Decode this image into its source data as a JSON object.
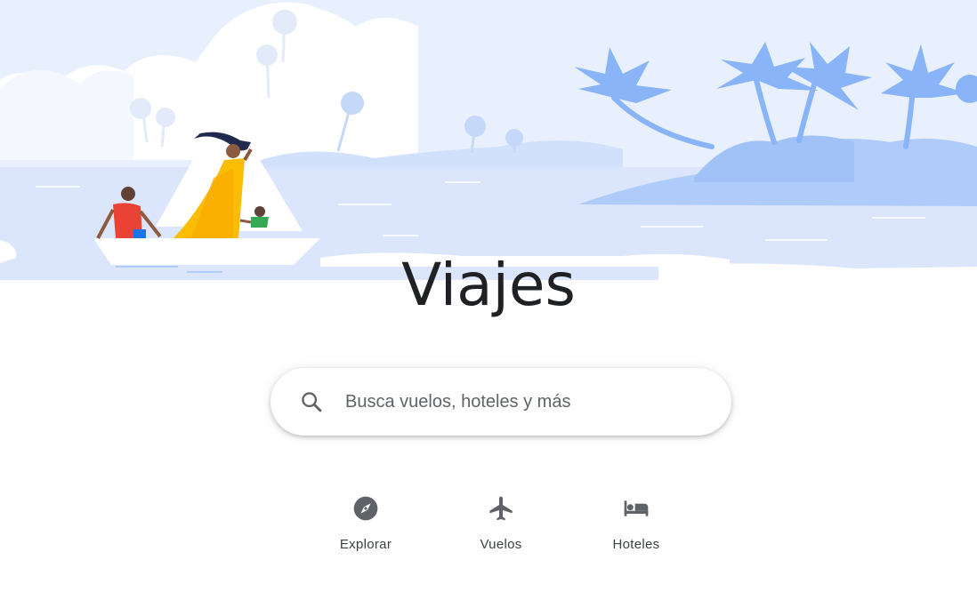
{
  "page": {
    "title": "Viajes"
  },
  "search": {
    "placeholder": "Busca vuelos, hoteles y más",
    "icon": "search-icon"
  },
  "nav": {
    "items": [
      {
        "label": "Explorar",
        "icon": "compass-icon"
      },
      {
        "label": "Vuelos",
        "icon": "airplane-icon"
      },
      {
        "label": "Hoteles",
        "icon": "bed-icon"
      }
    ]
  },
  "colors": {
    "sky": "#e8f0fe",
    "water": "#dbe6fc",
    "island": "#aecbfa",
    "island_dark": "#8ab4f8",
    "text": "#202124",
    "icon": "#5f6368"
  }
}
